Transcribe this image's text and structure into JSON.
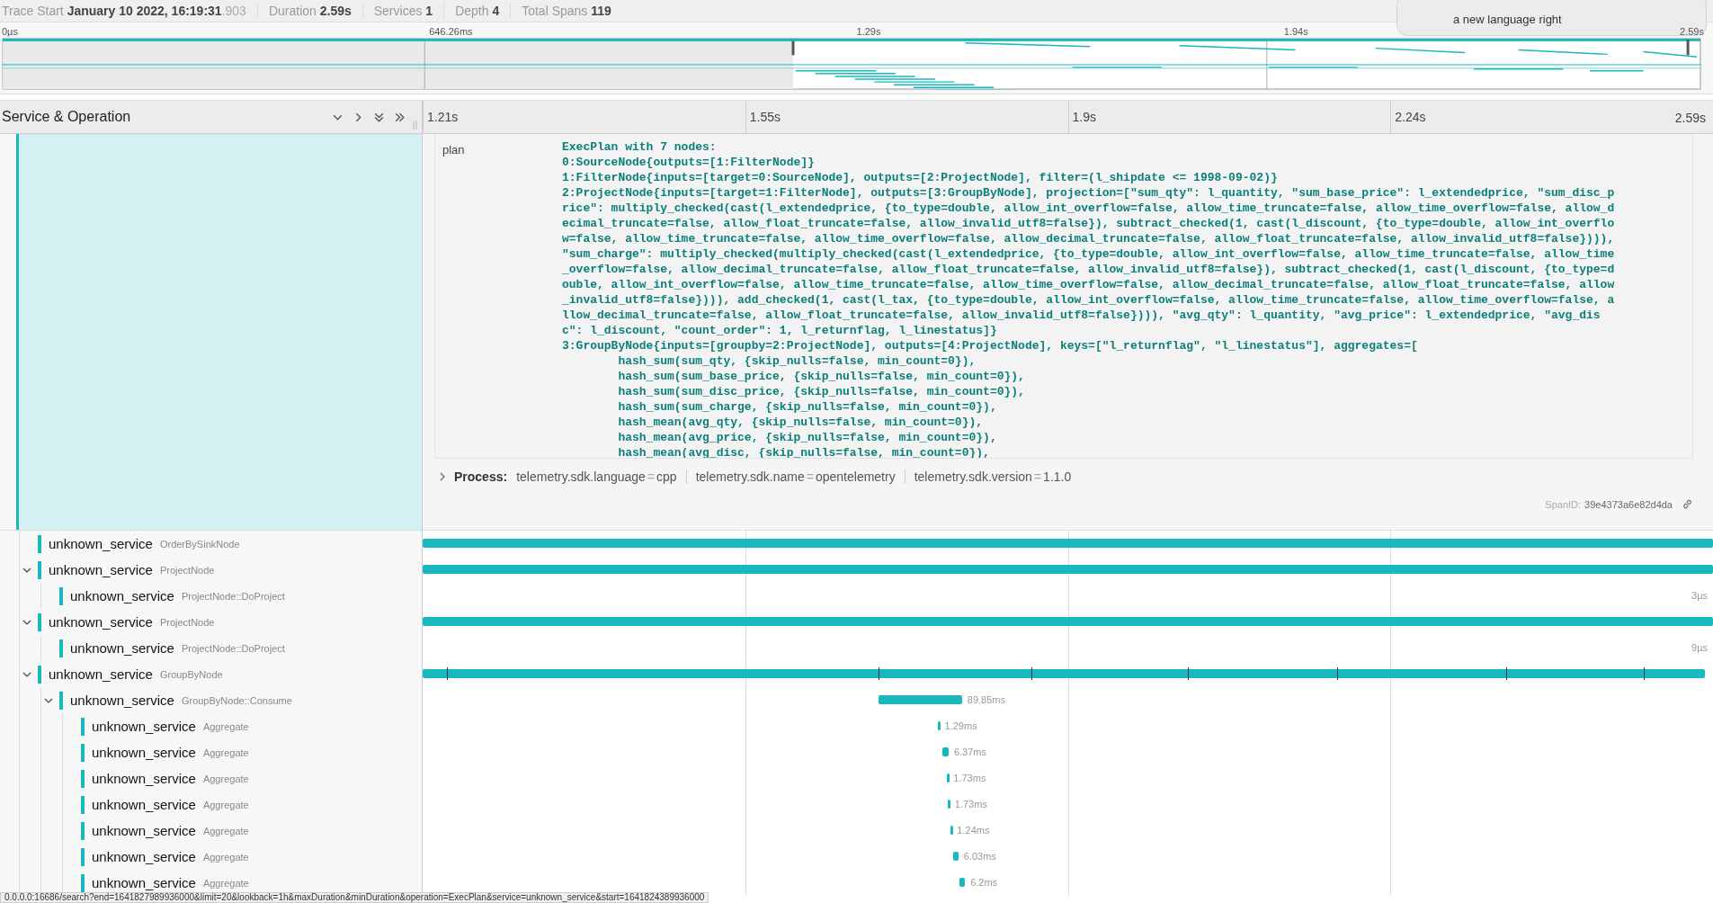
{
  "header": {
    "items": [
      {
        "label": "Trace Start",
        "value": "January 10 2022, 16:19:31",
        "suffix": ".903"
      },
      {
        "label": "Duration",
        "value": "2.59s"
      },
      {
        "label": "Services",
        "value": "1"
      },
      {
        "label": "Depth",
        "value": "4"
      },
      {
        "label": "Total Spans",
        "value": "119"
      }
    ]
  },
  "notification": {
    "text": "a new language right"
  },
  "minimap": {
    "ticks": [
      "0µs",
      "646.26ms",
      "1.29s",
      "1.94s",
      "2.59s"
    ]
  },
  "columns": {
    "title": "Service & Operation",
    "ticks": [
      "1.21s",
      "1.55s",
      "1.9s",
      "2.24s",
      "2.59s"
    ]
  },
  "detail": {
    "tags": [
      {
        "key": "plan",
        "value": "ExecPlan with 7 nodes:\n0:SourceNode{outputs=[1:FilterNode]}\n1:FilterNode{inputs=[target=0:SourceNode], outputs=[2:ProjectNode], filter=(l_shipdate <= 1998-09-02)}\n2:ProjectNode{inputs=[target=1:FilterNode], outputs=[3:GroupByNode], projection=[\"sum_qty\": l_quantity, \"sum_base_price\": l_extendedprice, \"sum_disc_p\nrice\": multiply_checked(cast(l_extendedprice, {to_type=double, allow_int_overflow=false, allow_time_truncate=false, allow_time_overflow=false, allow_d\necimal_truncate=false, allow_float_truncate=false, allow_invalid_utf8=false}), subtract_checked(1, cast(l_discount, {to_type=double, allow_int_overflo\nw=false, allow_time_truncate=false, allow_time_overflow=false, allow_decimal_truncate=false, allow_float_truncate=false, allow_invalid_utf8=false}))),\n\"sum_charge\": multiply_checked(multiply_checked(cast(l_extendedprice, {to_type=double, allow_int_overflow=false, allow_time_truncate=false, allow_time\n_overflow=false, allow_decimal_truncate=false, allow_float_truncate=false, allow_invalid_utf8=false}), subtract_checked(1, cast(l_discount, {to_type=d\nouble, allow_int_overflow=false, allow_time_truncate=false, allow_time_overflow=false, allow_decimal_truncate=false, allow_float_truncate=false, allow\n_invalid_utf8=false}))), add_checked(1, cast(l_tax, {to_type=double, allow_int_overflow=false, allow_time_truncate=false, allow_time_overflow=false, a\nllow_decimal_truncate=false, allow_float_truncate=false, allow_invalid_utf8=false}))), \"avg_qty\": l_quantity, \"avg_price\": l_extendedprice, \"avg_dis\nc\": l_discount, \"count_order\": 1, l_returnflag, l_linestatus]}\n3:GroupByNode{inputs=[groupby=2:ProjectNode], outputs=[4:ProjectNode], keys=[\"l_returnflag\", \"l_linestatus\"], aggregates=[\n        hash_sum(sum_qty, {skip_nulls=false, min_count=0}),\n        hash_sum(sum_base_price, {skip_nulls=false, min_count=0}),\n        hash_sum(sum_disc_price, {skip_nulls=false, min_count=0}),\n        hash_sum(sum_charge, {skip_nulls=false, min_count=0}),\n        hash_mean(avg_qty, {skip_nulls=false, min_count=0}),\n        hash_mean(avg_price, {skip_nulls=false, min_count=0}),\n        hash_mean(avg_disc, {skip_nulls=false, min_count=0}),"
      }
    ],
    "process": {
      "label": "Process:",
      "expanded": false,
      "items": [
        {
          "key": "telemetry.sdk.language",
          "op": "=",
          "value": "cpp"
        },
        {
          "key": "telemetry.sdk.name",
          "op": "=",
          "value": "opentelemetry"
        },
        {
          "key": "telemetry.sdk.version",
          "op": "=",
          "value": "1.1.0"
        }
      ]
    },
    "span_id": {
      "label": "SpanID:",
      "value": "39e4373a6e82d4da"
    }
  },
  "spans": [
    {
      "service": "unknown_service",
      "operation": "OrderBySinkNode"
    },
    {
      "service": "unknown_service",
      "operation": "ProjectNode",
      "expanded": true,
      "children": [
        {
          "service": "unknown_service",
          "operation": "ProjectNode::DoProject",
          "duration": "3µs"
        }
      ]
    },
    {
      "service": "unknown_service",
      "operation": "ProjectNode",
      "expanded": true,
      "children": [
        {
          "service": "unknown_service",
          "operation": "ProjectNode::DoProject",
          "duration": "9µs"
        }
      ]
    },
    {
      "service": "unknown_service",
      "operation": "GroupByNode",
      "expanded": true,
      "children": [
        {
          "service": "unknown_service",
          "operation": "GroupByNode::Consume",
          "duration": "89.85ms",
          "expanded": true,
          "children": [
            {
              "service": "unknown_service",
              "operation": "Aggregate",
              "duration": "1.29ms"
            },
            {
              "service": "unknown_service",
              "operation": "Aggregate",
              "duration": "6.37ms"
            },
            {
              "service": "unknown_service",
              "operation": "Aggregate",
              "duration": "1.73ms"
            },
            {
              "service": "unknown_service",
              "operation": "Aggregate",
              "duration": "1.73ms"
            },
            {
              "service": "unknown_service",
              "operation": "Aggregate",
              "duration": "1.24ms"
            },
            {
              "service": "unknown_service",
              "operation": "Aggregate",
              "duration": "6.03ms"
            },
            {
              "service": "unknown_service",
              "operation": "Aggregate",
              "duration": "6.2ms"
            }
          ]
        }
      ]
    }
  ],
  "status_bar": {
    "url": "0.0.0.0:16686/search?end=1641827989936000&limit=20&lookback=1h&maxDuration&minDuration&operation=ExecPlan&service=unknown_service&start=1641824389936000"
  }
}
